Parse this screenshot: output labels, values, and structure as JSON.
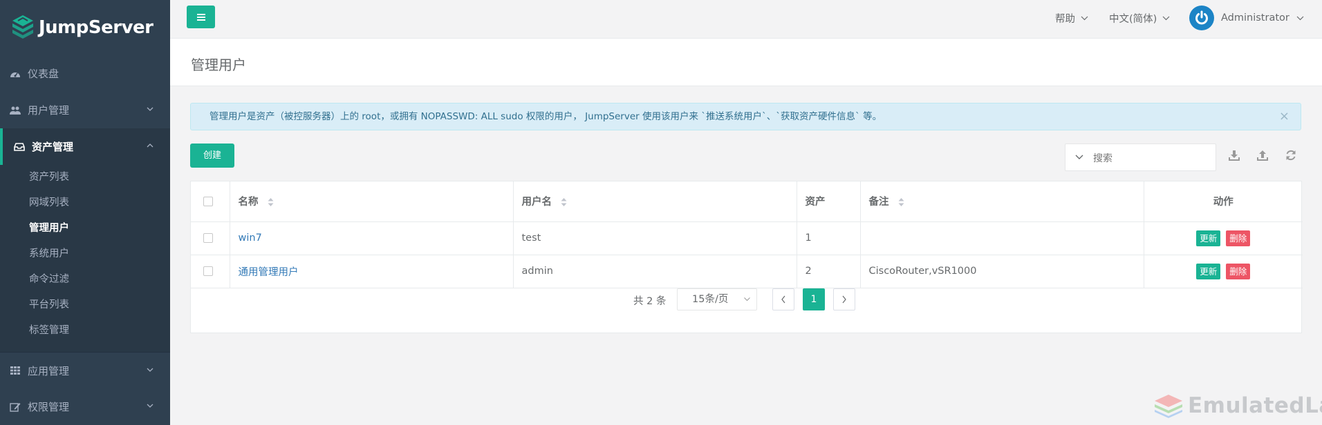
{
  "app": {
    "name": "JumpServer"
  },
  "sidebar": {
    "items": [
      {
        "label": "仪表盘",
        "icon": "dashboard-icon"
      },
      {
        "label": "用户管理",
        "icon": "users-icon"
      },
      {
        "label": "资产管理",
        "icon": "inbox-icon",
        "expanded": true
      },
      {
        "label": "应用管理",
        "icon": "grid-icon"
      },
      {
        "label": "权限管理",
        "icon": "edit-icon"
      }
    ],
    "asset_sub": [
      "资产列表",
      "网域列表",
      "管理用户",
      "系统用户",
      "命令过滤",
      "平台列表",
      "标签管理"
    ]
  },
  "topbar": {
    "help": "帮助",
    "language": "中文(简体)",
    "user": "Administrator"
  },
  "page": {
    "title": "管理用户"
  },
  "alert": {
    "text": "管理用户是资产（被控服务器）上的 root，或拥有 NOPASSWD: ALL sudo 权限的用户， JumpServer 使用该用户来 `推送系统用户`、`获取资产硬件信息` 等。",
    "close": "×"
  },
  "toolbar": {
    "create_label": "创建",
    "search_placeholder": "搜索"
  },
  "table": {
    "headers": {
      "name": "名称",
      "username": "用户名",
      "assets": "资产",
      "comment": "备注",
      "actions": "动作"
    },
    "rows": [
      {
        "name": "win7",
        "username": "test",
        "assets": "1",
        "comment": "",
        "update": "更新",
        "delete": "删除"
      },
      {
        "name": "通用管理用户",
        "username": "admin",
        "assets": "2",
        "comment": "CiscoRouter,vSR1000",
        "update": "更新",
        "delete": "删除"
      }
    ]
  },
  "pagination": {
    "total": "共 2 条",
    "page_size": "15条/页",
    "current_page": "1"
  },
  "watermark": "EmulatedLab",
  "colors": {
    "sidebar_bg": "#2f4050",
    "accent": "#1ab394",
    "danger": "#ed5565",
    "link": "#337ab7"
  }
}
